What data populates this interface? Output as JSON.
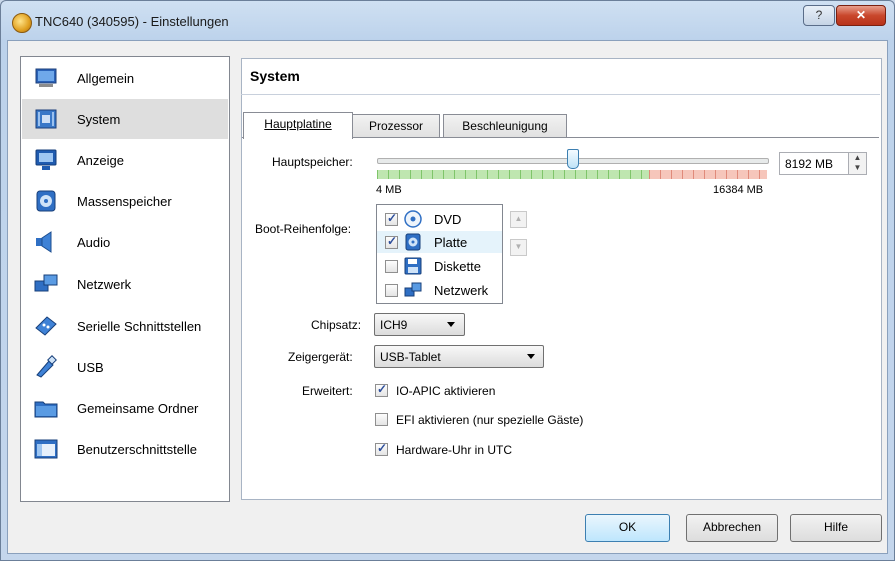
{
  "window": {
    "title": "TNC640 (340595) - Einstellungen"
  },
  "titlebar": {
    "help_glyph": "?",
    "close_glyph": "✕"
  },
  "sidebar": {
    "items": [
      {
        "label": "Allgemein",
        "icon": "monitor-icon"
      },
      {
        "label": "System",
        "icon": "motherboard-icon",
        "selected": true
      },
      {
        "label": "Anzeige",
        "icon": "display-icon"
      },
      {
        "label": "Massenspeicher",
        "icon": "disk-icon"
      },
      {
        "label": "Audio",
        "icon": "speaker-icon"
      },
      {
        "label": "Netzwerk",
        "icon": "network-icon"
      },
      {
        "label": "Serielle Schnittstellen",
        "icon": "serial-icon"
      },
      {
        "label": "USB",
        "icon": "usb-icon"
      },
      {
        "label": "Gemeinsame Ordner",
        "icon": "folder-icon"
      },
      {
        "label": "Benutzerschnittstelle",
        "icon": "window-icon"
      }
    ]
  },
  "panel": {
    "title": "System",
    "tabs": [
      {
        "label": "Hauptplatine",
        "active": true
      },
      {
        "label": "Prozessor"
      },
      {
        "label": "Beschleunigung"
      }
    ]
  },
  "memory": {
    "label": "Hauptspeicher:",
    "value": "8192 MB",
    "min_label": "4 MB",
    "max_label": "16384 MB",
    "value_mb": 8192,
    "min_mb": 4,
    "max_mb": 16384
  },
  "boot": {
    "label": "Boot-Reihenfolge:",
    "items": [
      {
        "label": "DVD",
        "checked": true,
        "icon": "dvd-icon"
      },
      {
        "label": "Platte",
        "checked": true,
        "icon": "harddisk-icon"
      },
      {
        "label": "Diskette",
        "checked": false,
        "icon": "floppy-icon"
      },
      {
        "label": "Netzwerk",
        "checked": false,
        "icon": "network-icon"
      }
    ],
    "up_glyph": "▲",
    "down_glyph": "▼"
  },
  "chipset": {
    "label": "Chipsatz:",
    "value": "ICH9"
  },
  "pointer": {
    "label": "Zeigergerät:",
    "value": "USB-Tablet"
  },
  "extended": {
    "label": "Erweitert:",
    "options": [
      {
        "label": "IO-APIC aktivieren",
        "checked": true
      },
      {
        "label": "EFI aktivieren (nur spezielle Gäste)",
        "checked": false
      },
      {
        "label": "Hardware-Uhr in UTC",
        "checked": true
      }
    ]
  },
  "buttons": {
    "ok": "OK",
    "cancel": "Abbrechen",
    "help": "Hilfe"
  },
  "colors": {
    "accent": "#3c7fb1",
    "slider_ok": "#7fc56a",
    "slider_warn": "#e08a7a"
  }
}
